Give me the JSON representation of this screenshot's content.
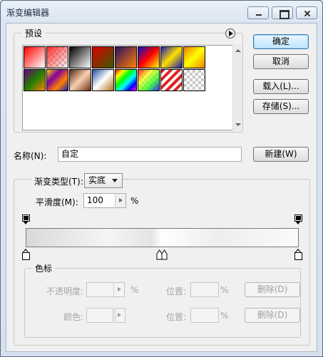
{
  "window": {
    "title": "渐变编辑器"
  },
  "presets": {
    "label": "预设",
    "swatches": [
      {
        "name": "foreground-to-background",
        "bg": "linear-gradient(135deg,#ff0000,#ffffff)"
      },
      {
        "name": "foreground-to-transparent",
        "bg": "linear-gradient(135deg,#ff3030,transparent), repeating-conic-gradient(#ccc 0 25%,#fff 0 50%) 0 0/8px 8px"
      },
      {
        "name": "black-white",
        "bg": "linear-gradient(135deg,#000,#fff)"
      },
      {
        "name": "red-green",
        "bg": "linear-gradient(135deg,#e00000,#3a5a00)"
      },
      {
        "name": "violet-orange",
        "bg": "linear-gradient(135deg,#2a1060,#ff8000)"
      },
      {
        "name": "blue-red-yellow",
        "bg": "linear-gradient(135deg,#1010c0,#ff0000,#ffff00)"
      },
      {
        "name": "blue-yellow-blue",
        "bg": "linear-gradient(135deg,#1a1ab0,#ffe000,#1a1ab0)"
      },
      {
        "name": "orange-yellow-orange",
        "bg": "linear-gradient(135deg,#f08000,#ffff00,#f08000)"
      },
      {
        "name": "violet-green-orange",
        "bg": "linear-gradient(135deg,#6a0080,#208000,#ff8000)"
      },
      {
        "name": "yellow-violet-orange-blue",
        "bg": "linear-gradient(135deg,#ffd000,#8000a0,#ff8000,#1020c0)"
      },
      {
        "name": "copper",
        "bg": "linear-gradient(135deg,#5a2a10,#f8d0b0,#6a3010)"
      },
      {
        "name": "chrome",
        "bg": "linear-gradient(135deg,#2050a0,#ffffff 50%,#b07020)"
      },
      {
        "name": "spectrum",
        "bg": "linear-gradient(135deg,#ff0000,#ff0 20%,#0f0 40%,#0ff 60%,#00f 80%,#f0f)"
      },
      {
        "name": "transparent-rainbow",
        "bg": "linear-gradient(135deg,rgba(255,0,0,.8),rgba(255,255,0,.7),rgba(0,255,0,.7),rgba(0,0,255,.8)), repeating-conic-gradient(#ccc 0 25%,#fff 0 50%) 0 0/8px 8px"
      },
      {
        "name": "transparent-stripes",
        "bg": "repeating-linear-gradient(135deg,#e02020 0 4px,#ffffff 4px 8px)"
      },
      {
        "name": "transparent-checker",
        "bg": "repeating-conic-gradient(#c8c8c8 0 25%,#ffffff 0 50%) 0 0/8px 8px"
      }
    ]
  },
  "buttons": {
    "ok": "确定",
    "cancel": "取消",
    "load": "载入(L)...",
    "save": "存储(S)...",
    "new": "新建(W)",
    "delete": "删除(D)"
  },
  "name": {
    "label": "名称(N):",
    "value": "自定"
  },
  "gradient_type": {
    "label": "渐变类型(T):",
    "value": "实底"
  },
  "smoothness": {
    "label": "平滑度(M):",
    "value": "100",
    "unit": "%"
  },
  "color_stops": {
    "label": "色标",
    "opacity_label": "不透明度:",
    "percent": "%",
    "color_label": "颜色:",
    "location_label": "位置:"
  },
  "colors": {
    "gradient": "linear-gradient(90deg,#d9d9d9 0%,#f5f5f5 30%,#e4e4e4 46%,#ffffff 50%,#eeeeee 70%,#fafafa 100%)"
  }
}
